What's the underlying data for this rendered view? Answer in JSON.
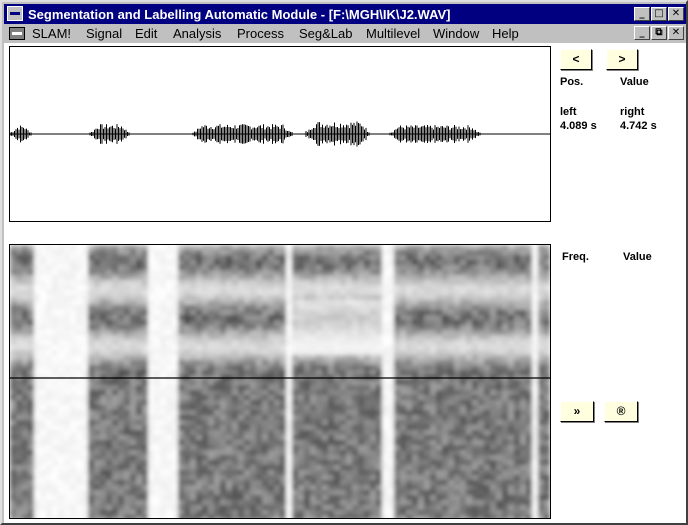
{
  "window": {
    "title": "Segmentation and Labelling Automatic Module - [F:\\MGH\\IK\\J2.WAV]",
    "controls": {
      "minimize": "_",
      "maximize": "□",
      "close": "✕",
      "restore": "⧉"
    }
  },
  "menu": {
    "items": [
      {
        "label": "SLAM!"
      },
      {
        "label": "Signal"
      },
      {
        "label": "Edit"
      },
      {
        "label": "Analysis"
      },
      {
        "label": "Process"
      },
      {
        "label": "Seg&Lab"
      },
      {
        "label": "Multilevel"
      },
      {
        "label": "Window"
      },
      {
        "label": "Help"
      }
    ]
  },
  "waveform_panel": {
    "nav_prev": "<",
    "nav_next": ">",
    "pos_label": "Pos.",
    "value_label": "Value",
    "left_label": "left",
    "right_label": "right",
    "left_value": "4.089 s",
    "right_value": "4.742 s"
  },
  "spectrogram_panel": {
    "freq_label": "Freq.",
    "value_label": "Value",
    "forward_button": "»",
    "record_button": "®"
  },
  "icons": {
    "system_menu": "app-menu-icon",
    "mdi_menu": "document-menu-icon"
  }
}
